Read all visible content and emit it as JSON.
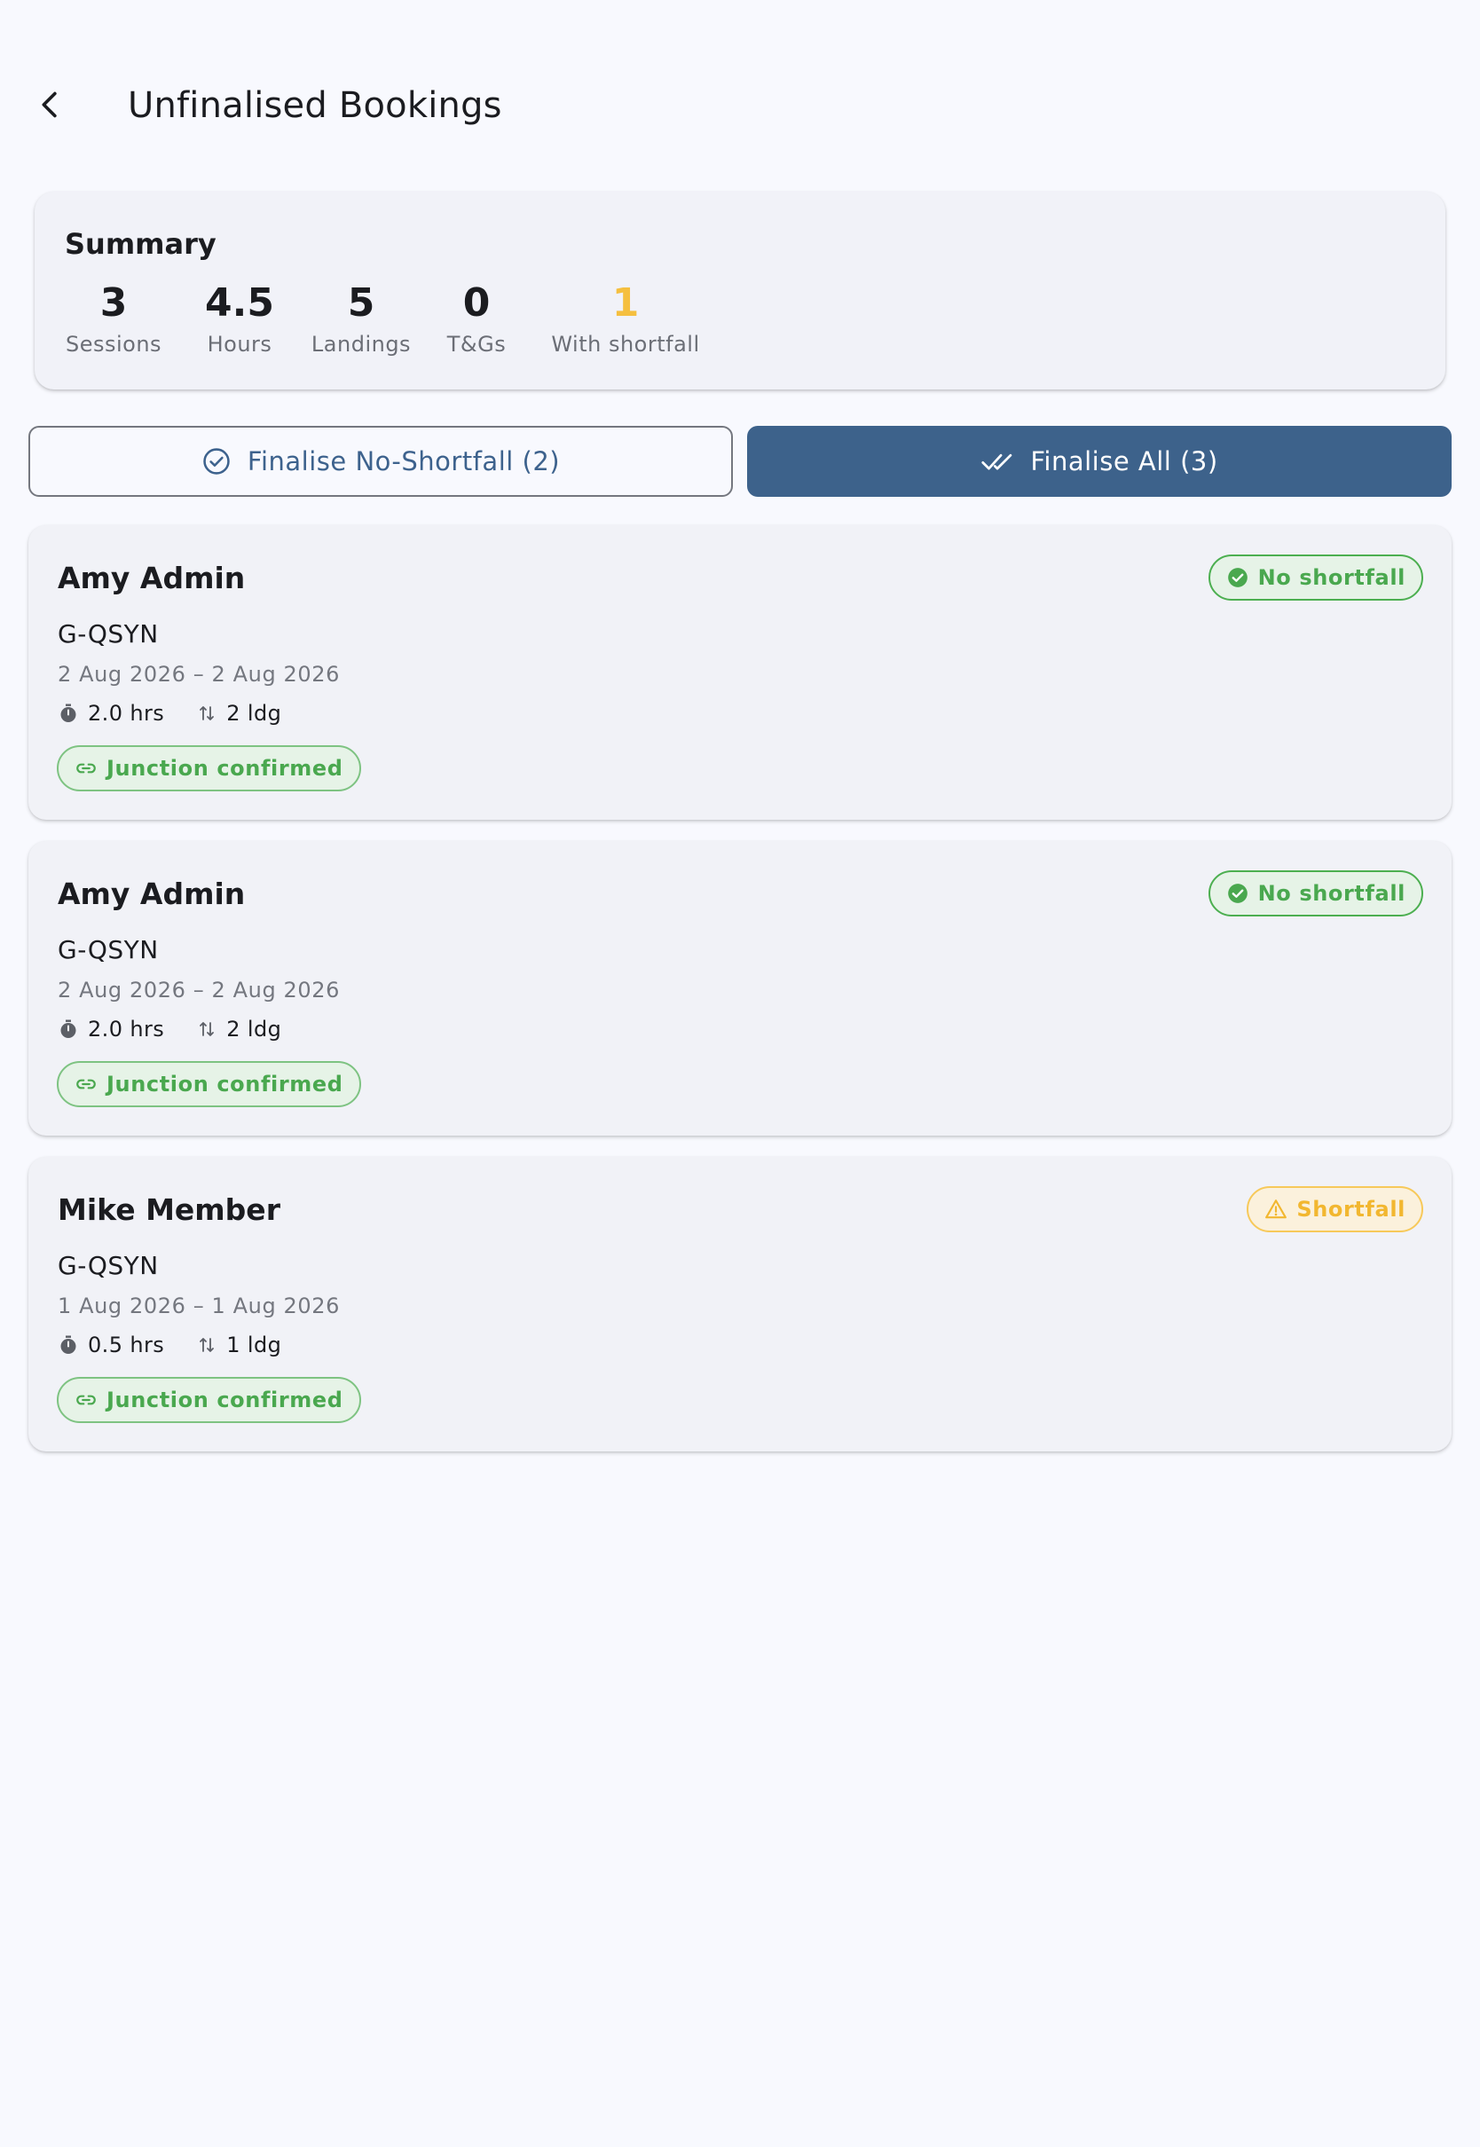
{
  "header": {
    "title": "Unfinalised Bookings"
  },
  "summary": {
    "title": "Summary",
    "stats": [
      {
        "value": "3",
        "label": "Sessions"
      },
      {
        "value": "4.5",
        "label": "Hours"
      },
      {
        "value": "5",
        "label": "Landings"
      },
      {
        "value": "0",
        "label": "T&Gs"
      },
      {
        "value": "1",
        "label": "With shortfall"
      }
    ],
    "warn_color": "#f5bf3f"
  },
  "actions": {
    "finalise_no_shortfall": "Finalise No-Shortfall (2)",
    "finalise_all": "Finalise All (3)"
  },
  "bookings": [
    {
      "member": "Amy Admin",
      "aircraft": "G-QSYN",
      "dates": "2 Aug 2026 – 2 Aug 2026",
      "hours": "2.0 hrs",
      "landings": "2 ldg",
      "junction": "Junction confirmed",
      "status": "No shortfall",
      "status_type": "ok"
    },
    {
      "member": "Amy Admin",
      "aircraft": "G-QSYN",
      "dates": "2 Aug 2026 – 2 Aug 2026",
      "hours": "2.0 hrs",
      "landings": "2 ldg",
      "junction": "Junction confirmed",
      "status": "No shortfall",
      "status_type": "ok"
    },
    {
      "member": "Mike Member",
      "aircraft": "G-QSYN",
      "dates": "1 Aug 2026 – 1 Aug 2026",
      "hours": "0.5 hrs",
      "landings": "1 ldg",
      "junction": "Junction confirmed",
      "status": "Shortfall",
      "status_type": "warn"
    }
  ],
  "colors": {
    "primary": "#3d628b",
    "success": "#4aa84f",
    "warning": "#f2b730",
    "background": "#f8f9fe"
  },
  "icons": {
    "back": "arrow-back-icon",
    "check_circle_outline": "check-circle-outline-icon",
    "done_all": "done-all-icon",
    "timer": "timer-icon",
    "landing": "swap-vert-icon",
    "link": "link-icon",
    "check_circle": "check-circle-icon",
    "warning": "warning-triangle-icon"
  }
}
